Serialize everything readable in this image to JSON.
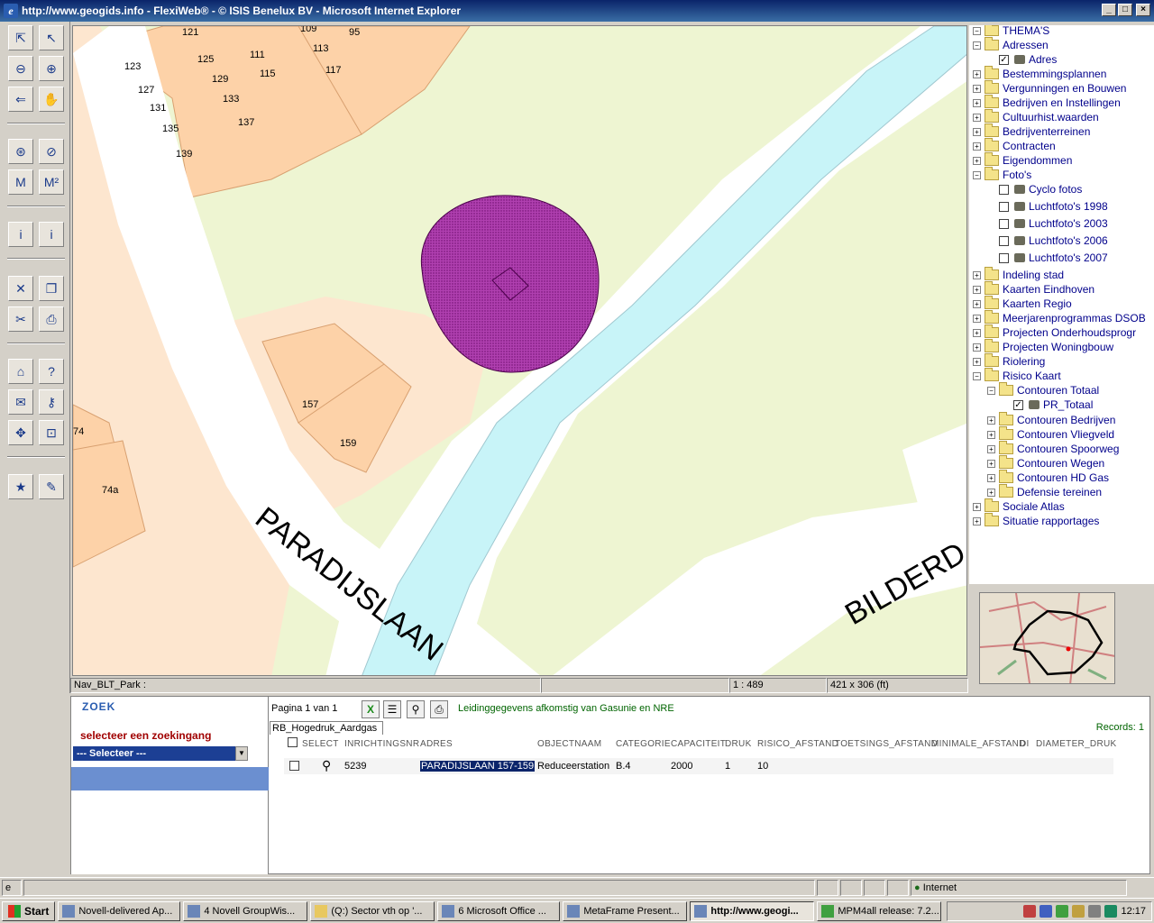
{
  "window": {
    "title": "http://www.geogids.info - FlexiWeb® - © ISIS Benelux BV - Microsoft Internet Explorer"
  },
  "map": {
    "house_numbers": [
      "121",
      "109",
      "95",
      "123",
      "125",
      "111",
      "113",
      "117",
      "115",
      "127",
      "129",
      "133",
      "131",
      "137",
      "135",
      "139",
      "157",
      "159",
      "74",
      "74a"
    ],
    "street_labels": [
      "PARADIJSLAAN",
      "BILDERD"
    ],
    "status": {
      "layer": "Nav_BLT_Park :",
      "scale": "1 : 489",
      "extent": "421 x 306 (ft)"
    }
  },
  "tree": {
    "root": "THEMA'S",
    "items": [
      {
        "label": "Adressen",
        "indent": 1,
        "exp": "-"
      },
      {
        "label": "Adres",
        "indent": 2,
        "check": "✓",
        "leaf": true
      },
      {
        "label": "Bestemmingsplannen",
        "indent": 1,
        "exp": "+"
      },
      {
        "label": "Vergunningen en Bouwen",
        "indent": 1,
        "exp": "+"
      },
      {
        "label": "Bedrijven en Instellingen",
        "indent": 1,
        "exp": "+"
      },
      {
        "label": "Cultuurhist.waarden",
        "indent": 1,
        "exp": "+"
      },
      {
        "label": "Bedrijventerreinen",
        "indent": 1,
        "exp": "+"
      },
      {
        "label": "Contracten",
        "indent": 1,
        "exp": "+"
      },
      {
        "label": "Eigendommen",
        "indent": 1,
        "exp": "+"
      },
      {
        "label": "Foto's",
        "indent": 1,
        "exp": "-"
      },
      {
        "label": "Cyclo fotos",
        "indent": 2,
        "check": "",
        "leaf": true
      },
      {
        "label": "Luchtfoto's 1998",
        "indent": 2,
        "check": "",
        "leaf": true
      },
      {
        "label": "Luchtfoto's 2003",
        "indent": 2,
        "check": "",
        "leaf": true
      },
      {
        "label": "Luchtfoto's 2006",
        "indent": 2,
        "check": "",
        "leaf": true
      },
      {
        "label": "Luchtfoto's 2007",
        "indent": 2,
        "check": "",
        "leaf": true
      },
      {
        "label": "Indeling stad",
        "indent": 1,
        "exp": "+"
      },
      {
        "label": "Kaarten Eindhoven",
        "indent": 1,
        "exp": "+"
      },
      {
        "label": "Kaarten Regio",
        "indent": 1,
        "exp": "+"
      },
      {
        "label": "Meerjarenprogrammas DSOB",
        "indent": 1,
        "exp": "+"
      },
      {
        "label": "Projecten Onderhoudsprogr",
        "indent": 1,
        "exp": "+"
      },
      {
        "label": "Projecten Woningbouw",
        "indent": 1,
        "exp": "+"
      },
      {
        "label": "Riolering",
        "indent": 1,
        "exp": "+"
      },
      {
        "label": "Risico Kaart",
        "indent": 1,
        "exp": "-"
      },
      {
        "label": "Contouren Totaal",
        "indent": 2,
        "exp": "-"
      },
      {
        "label": "PR_Totaal",
        "indent": 3,
        "check": "✓",
        "leaf": true
      },
      {
        "label": "Contouren Bedrijven",
        "indent": 2,
        "exp": "+"
      },
      {
        "label": "Contouren Vliegveld",
        "indent": 2,
        "exp": "+"
      },
      {
        "label": "Contouren Spoorweg",
        "indent": 2,
        "exp": "+"
      },
      {
        "label": "Contouren Wegen",
        "indent": 2,
        "exp": "+"
      },
      {
        "label": "Contouren HD Gas",
        "indent": 2,
        "exp": "+"
      },
      {
        "label": "Defensie tereinen",
        "indent": 2,
        "exp": "+"
      },
      {
        "label": "Sociale Atlas",
        "indent": 1,
        "exp": "+"
      },
      {
        "label": "Situatie rapportages",
        "indent": 1,
        "exp": "+"
      }
    ]
  },
  "search": {
    "title": "ZOEK",
    "heading": "selecteer een zoekingang",
    "select_value": "--- Selecteer ---"
  },
  "results": {
    "pagina": "Pagina 1 van 1",
    "info": "Leidinggegevens afkomstig van Gasunie en NRE",
    "tab": "RB_Hogedruk_Aardgas",
    "records": "Records: 1",
    "columns": [
      "SELECT",
      "INRICHTINGSNR",
      "ADRES",
      "OBJECTNAAM",
      "CATEGORIE",
      "CAPACITEIT",
      "DRUK",
      "RISICO_AFSTAND",
      "TOETSINGS_AFSTAND",
      "MINIMALE_AFSTAND",
      "DI",
      "DIAMETER_DRUK"
    ],
    "row": {
      "inrichtingsnr": "5239",
      "adres": "PARADIJSLAAN 157-159",
      "objectnaam": "Reduceerstation",
      "categorie": "B.4",
      "capaciteit": "2000",
      "druk": "1",
      "risico_afstand": "10"
    }
  },
  "ie_status": {
    "zone": "Internet"
  },
  "taskbar": {
    "start": "Start",
    "tasks": [
      "Novell-delivered Ap...",
      "4 Novell GroupWis...",
      "(Q:) Sector vth op '...",
      "6 Microsoft Office ...",
      "MetaFrame Present...",
      "http://www.geogi...",
      "MPM4all release: 7.2..."
    ],
    "clock": "12:17"
  },
  "colors": {
    "water": "#c8f4f8",
    "park": "#eef5d2",
    "plot": "#fdd2a8",
    "plot_light": "#fde6cf",
    "contour": "#8b1a8b"
  }
}
